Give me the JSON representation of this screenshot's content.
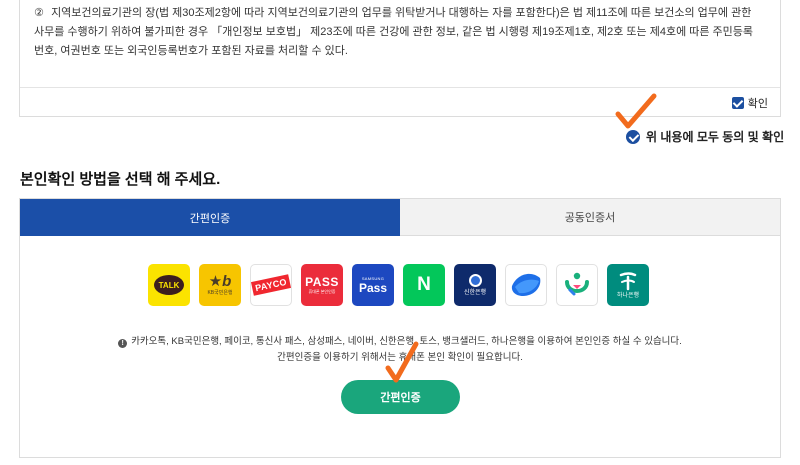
{
  "consent": {
    "item_number": "②",
    "text": "지역보건의료기관의 장(법 제30조제2항에 따라 지역보건의료기관의 업무를 위탁받거나 대행하는 자를 포함한다)은 법 제11조에 따른 보건소의 업무에 관한 사무를 수행하기 위하여 불가피한 경우 「개인정보 보호법」 제23조에 따른 건강에 관한 정보, 같은 법 시행령 제19조제1호, 제2호 또는 제4호에 따른 주민등록번호, 여권번호 또는 외국인등록번호가 포함된 자료를 처리할 수 있다.",
    "confirm_label": "확인",
    "confirm_checked": true
  },
  "agree_all": {
    "label": "위 내용에 모두 동의 및 확인",
    "checked": true
  },
  "section": {
    "title": "본인확인 방법을 선택 해 주세요."
  },
  "tabs": [
    {
      "label": "간편인증",
      "active": true
    },
    {
      "label": "공동인증서",
      "active": false
    }
  ],
  "providers": {
    "kakao": {
      "label": "TALK"
    },
    "kb": {
      "mark": "★b",
      "label": "KB국민은행"
    },
    "payco": {
      "label": "PAYCO"
    },
    "pass": {
      "label": "PASS",
      "sub": "휴대폰 본인인증"
    },
    "samsung": {
      "brand": "SAMSUNG",
      "label": "Pass"
    },
    "naver": {
      "label": "N"
    },
    "shinhan": {
      "label": "신한은행"
    },
    "hana": {
      "label": "하나은행"
    }
  },
  "notice": {
    "line1": "카카오톡, KB국민은행, 페이코, 통신사 패스, 삼성패스, 네이버, 신한은행, 토스, 뱅크샐러드, 하나은행을 이용하여 본인인증 하실 수 있습니다.",
    "line2": "간편인증을 이용하기 위해서는 휴대폰 본인 확인이 필요합니다."
  },
  "submit": {
    "label": "간편인증"
  },
  "colors": {
    "primary_blue": "#1b4fa8",
    "submit_green": "#1aa67c",
    "annotation_orange": "#f26b1d"
  }
}
